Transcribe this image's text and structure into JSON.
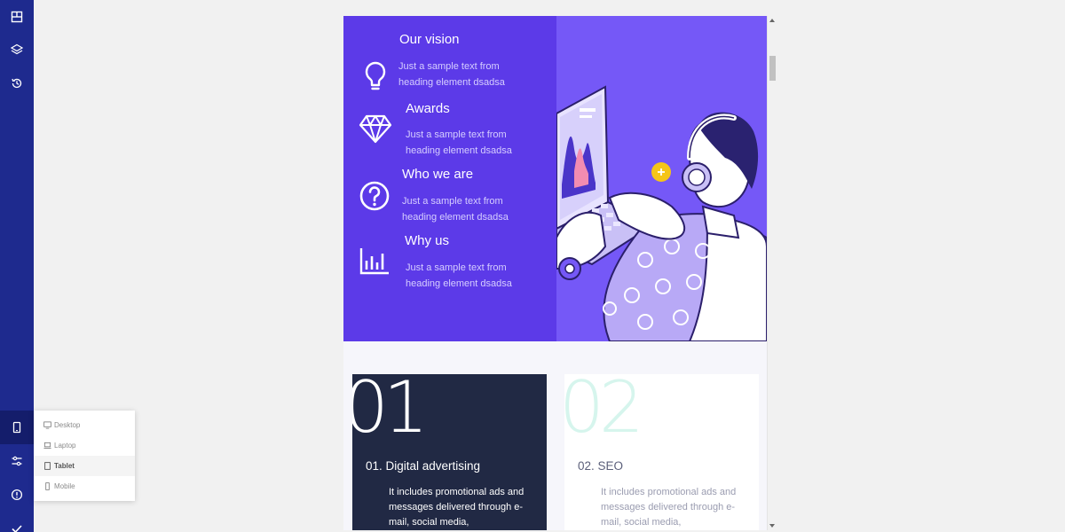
{
  "sidebar": {
    "icons": [
      "layout-icon",
      "layers-icon",
      "history-icon",
      "device-icon",
      "settings-sliders-icon",
      "info-icon",
      "check-icon"
    ],
    "active": "device-icon"
  },
  "device_menu": {
    "items": [
      {
        "label": "Desktop",
        "icon": "desktop-icon"
      },
      {
        "label": "Laptop",
        "icon": "laptop-icon"
      },
      {
        "label": "Tablet",
        "icon": "tablet-icon"
      },
      {
        "label": "Mobile",
        "icon": "mobile-icon"
      }
    ],
    "selected": "Tablet"
  },
  "features": [
    {
      "title": "Our vision",
      "text": "Just a sample text from heading element dsadsa",
      "icon": "lightbulb-icon"
    },
    {
      "title": "Awards",
      "text": "Just a sample text from heading element dsadsa",
      "icon": "diamond-icon"
    },
    {
      "title": "Who we are",
      "text": "Just a sample text from heading element dsadsa",
      "icon": "question-icon"
    },
    {
      "title": "Why us",
      "text": "Just a sample text from heading element dsadsa",
      "icon": "bar-chart-icon"
    }
  ],
  "services": [
    {
      "number": "01",
      "title": "01. Digital advertising",
      "text": "It includes promotional ads and messages delivered through e-mail, social media,"
    },
    {
      "number": "02",
      "title": "02. SEO",
      "text": "It includes promotional ads and messages delivered through e-mail, social media,"
    }
  ],
  "colors": {
    "sidebar": "#1e2a8e",
    "hero_left": "#5c3ae8",
    "hero_right": "#7558f7",
    "card_dark": "#212944",
    "card_light_number": "#d6f5ed",
    "accent_yellow": "#f5c518"
  }
}
